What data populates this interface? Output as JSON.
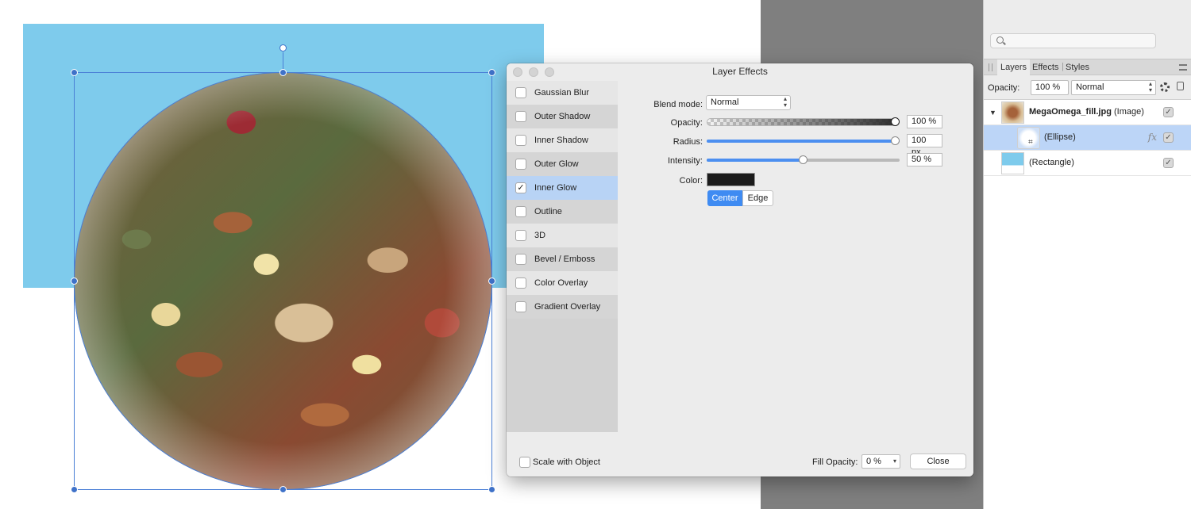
{
  "dialog": {
    "title": "Layer Effects",
    "effects": [
      {
        "label": "Gaussian Blur",
        "checked": false
      },
      {
        "label": "Outer Shadow",
        "checked": false
      },
      {
        "label": "Inner Shadow",
        "checked": false
      },
      {
        "label": "Outer Glow",
        "checked": false
      },
      {
        "label": "Inner Glow",
        "checked": true
      },
      {
        "label": "Outline",
        "checked": false
      },
      {
        "label": "3D",
        "checked": false
      },
      {
        "label": "Bevel / Emboss",
        "checked": false
      },
      {
        "label": "Color Overlay",
        "checked": false
      },
      {
        "label": "Gradient Overlay",
        "checked": false
      }
    ],
    "selected_effect": "Inner Glow",
    "settings": {
      "blend_mode_label": "Blend mode:",
      "blend_mode_value": "Normal",
      "opacity_label": "Opacity:",
      "opacity_value": "100 %",
      "opacity_level": 1.0,
      "radius_label": "Radius:",
      "radius_value": "100 px",
      "radius_level": 1.0,
      "intensity_label": "Intensity:",
      "intensity_value": "50 %",
      "intensity_level": 0.5,
      "color_label": "Color:",
      "color_value": "#1b1b1b",
      "center_label": "Center",
      "edge_label": "Edge"
    },
    "footer": {
      "scale_with_object_label": "Scale with Object",
      "fill_opacity_label": "Fill Opacity:",
      "fill_opacity_value": "0 %",
      "close_label": "Close"
    }
  },
  "layers_panel": {
    "tabs": [
      "Layers",
      "Effects",
      "Styles"
    ],
    "active_tab": "Layers",
    "opacity_label": "Opacity:",
    "opacity_value": "100 %",
    "blend_value": "Normal",
    "layers": [
      {
        "name": "MegaOmega_fill.jpg",
        "suffix": " (Image)",
        "visible": true
      },
      {
        "name": "(Ellipse)",
        "suffix": "",
        "visible": true,
        "has_fx": true
      },
      {
        "name": "(Rectangle)",
        "suffix": "",
        "visible": true
      }
    ]
  },
  "colors": {
    "canvas_rect": "#7ecbec",
    "selection": "#4a7fd6",
    "accent": "#3f8bf2",
    "pasteboard": "#7f7f7f"
  },
  "icons": {
    "fx": "fx"
  }
}
